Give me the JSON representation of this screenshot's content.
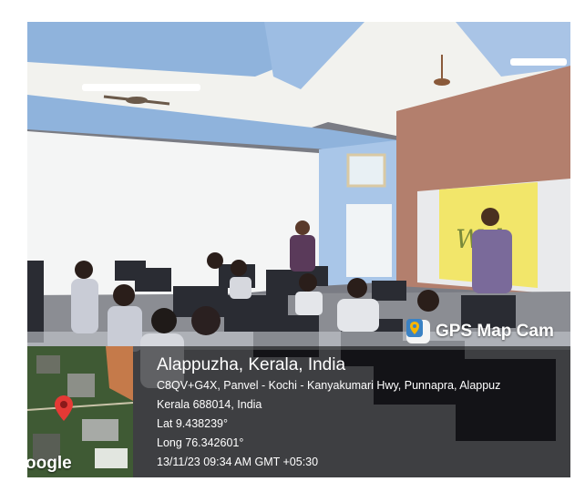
{
  "app": {
    "name": "GPS Map Cam",
    "icon": "map-pin-app-icon"
  },
  "location": {
    "title": "Alappuzha, Kerala, India",
    "address_line1": "C8QV+G4X, Panvel - Kochi - Kanyakumari Hwy, Punnapra, Alappuz",
    "address_line2": "Kerala 688014, India",
    "lat": "Lat 9.438239°",
    "long": "Long 76.342601°",
    "datetime": "13/11/23 09:34 AM GMT +05:30"
  },
  "map": {
    "attribution": "oogle",
    "marker_icon": "map-marker-icon",
    "marker_color": "#e53935"
  },
  "screen": {
    "welcome_text": "Wel"
  },
  "colors": {
    "ceiling_blue": "#8fb3dc",
    "wall_brown": "#b37f6d",
    "screen_yellow": "#f2e66a"
  }
}
